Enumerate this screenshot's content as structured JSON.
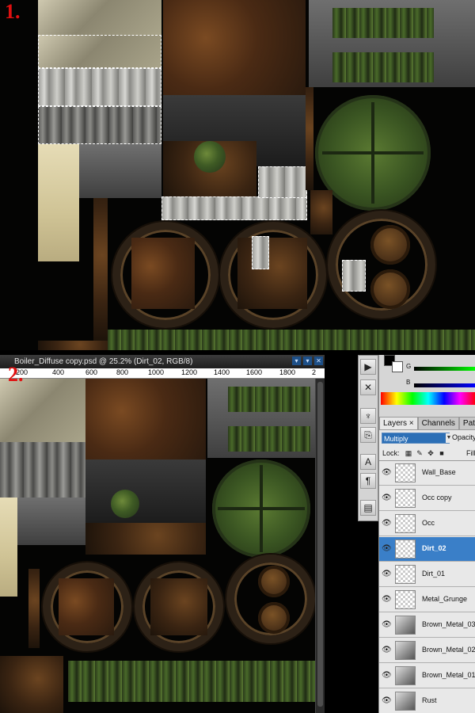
{
  "steps": {
    "one": "1.",
    "two": "2."
  },
  "document": {
    "title": "Boiler_Diffuse copy.psd @ 25.2% (Dirt_02, RGB/8)",
    "window_buttons": [
      "▾",
      "▾",
      "✕"
    ]
  },
  "ruler": {
    "ticks": [
      "200",
      "400",
      "600",
      "800",
      "1000",
      "1200",
      "1400",
      "1600",
      "1800",
      "2"
    ]
  },
  "color_panel": {
    "slider_g": "G",
    "slider_b": "B",
    "foreground": "#000000",
    "background": "#ffffff"
  },
  "layers_panel": {
    "tabs": [
      {
        "label": "Layers ×",
        "active": true
      },
      {
        "label": "Channels",
        "active": false
      },
      {
        "label": "Paths",
        "active": false
      }
    ],
    "blend_mode": "Multiply",
    "opacity_label": "Opacity:",
    "lock_label": "Lock:",
    "fill_label": "Fill:",
    "lock_icons": [
      "lock-transparency-icon",
      "lock-image-icon",
      "lock-position-icon",
      "lock-all-icon"
    ],
    "layers": [
      {
        "name": "Wall_Base",
        "selected": false
      },
      {
        "name": "Occ copy",
        "selected": false
      },
      {
        "name": "Occ",
        "selected": false
      },
      {
        "name": "Dirt_02",
        "selected": true
      },
      {
        "name": "Dirt_01",
        "selected": false
      },
      {
        "name": "Metal_Grunge",
        "selected": false
      },
      {
        "name": "Brown_Metal_03",
        "selected": false
      },
      {
        "name": "Brown_Metal_02",
        "selected": false
      },
      {
        "name": "Brown_Metal_01",
        "selected": false
      },
      {
        "name": "Rust",
        "selected": false
      }
    ]
  },
  "tool_strip": {
    "icons": [
      "play-icon",
      "tools-icon",
      "brush-icon",
      "clone-icon",
      "character-icon",
      "paragraph-icon",
      "layer-comps-icon"
    ]
  }
}
